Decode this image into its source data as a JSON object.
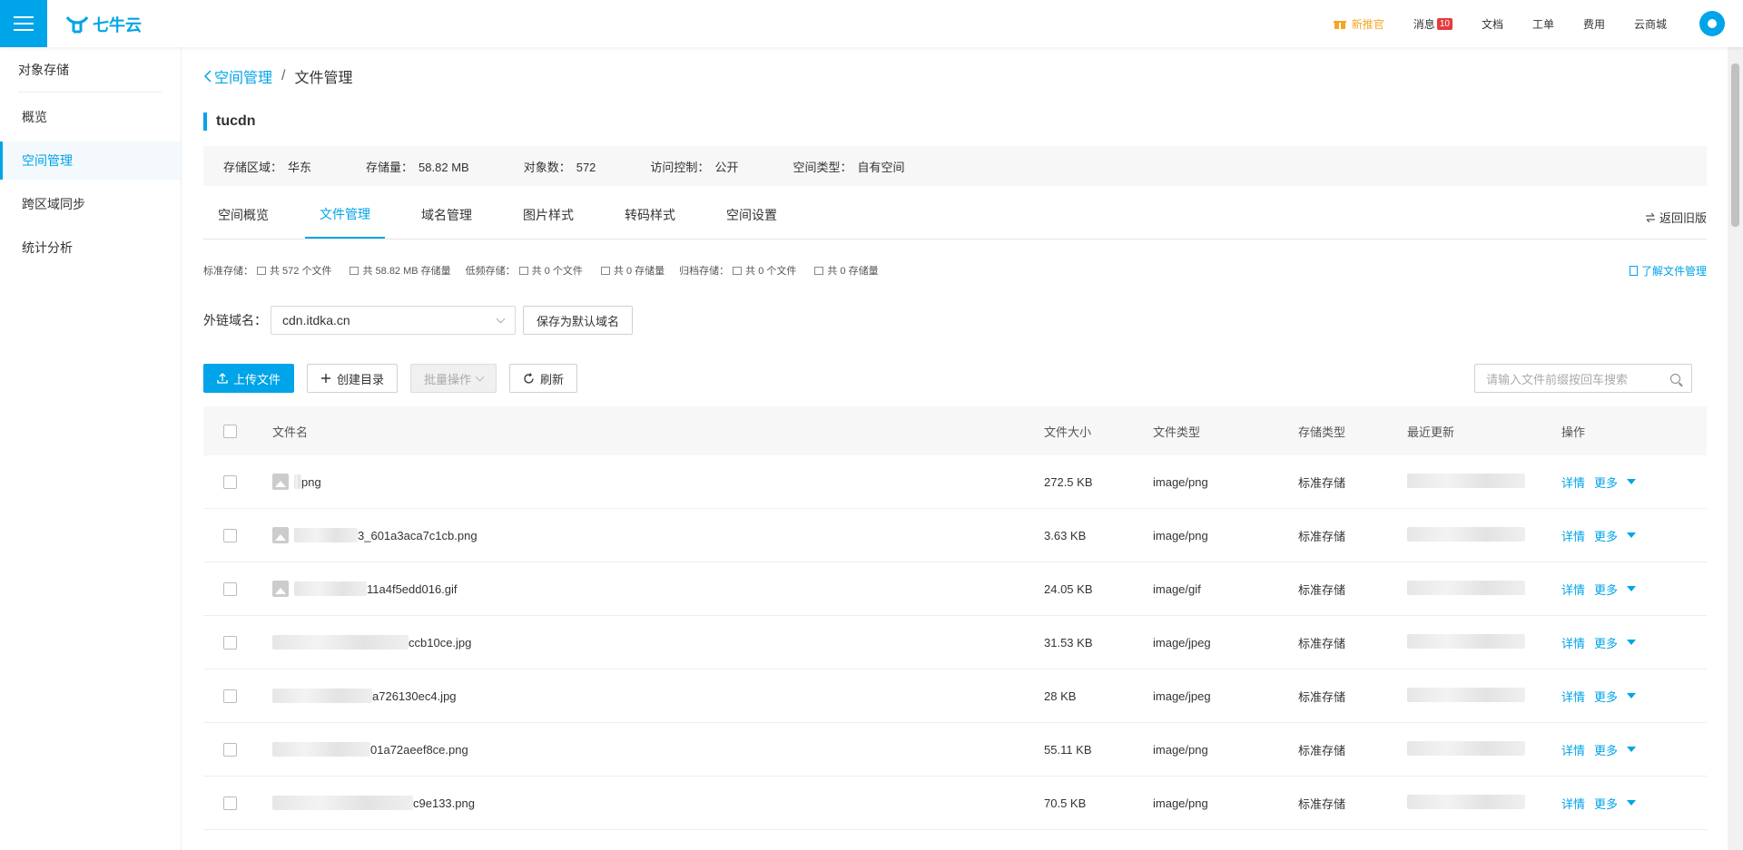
{
  "header": {
    "logo_text": "七牛云",
    "promo": "新推官",
    "messages": "消息",
    "messages_count": "10",
    "docs": "文档",
    "tickets": "工单",
    "billing": "费用",
    "mall": "云商城"
  },
  "sidebar": {
    "title": "对象存储",
    "items": [
      {
        "label": "概览"
      },
      {
        "label": "空间管理"
      },
      {
        "label": "跨区域同步"
      },
      {
        "label": "统计分析"
      }
    ]
  },
  "breadcrumb": {
    "back": "空间管理",
    "separator": "/",
    "current": "文件管理"
  },
  "bucket": {
    "name": "tucdn",
    "region_label": "存储区域：",
    "region": "华东",
    "usage_label": "存储量：",
    "usage": "58.82 MB",
    "objects_label": "对象数：",
    "objects": "572",
    "access_label": "访问控制：",
    "access": "公开",
    "type_label": "空间类型：",
    "type": "自有空间"
  },
  "tabs": [
    {
      "label": "空间概览"
    },
    {
      "label": "文件管理"
    },
    {
      "label": "域名管理"
    },
    {
      "label": "图片样式"
    },
    {
      "label": "转码样式"
    },
    {
      "label": "空间设置"
    }
  ],
  "old_version": "返回旧版",
  "stats": {
    "standard": "标准存储：",
    "standard_files": "共 572 个文件",
    "standard_size": "共 58.82 MB 存储量",
    "low": "低频存储：",
    "low_files": "共 0 个文件",
    "low_size": "共 0 存储量",
    "archive": "归档存储：",
    "archive_files": "共 0 个文件",
    "archive_size": "共 0 存储量",
    "learn": "了解文件管理"
  },
  "domain": {
    "label": "外链域名：",
    "value": "cdn.itdka.cn",
    "save_btn": "保存为默认域名"
  },
  "toolbar": {
    "upload": "上传文件",
    "mkdir": "创建目录",
    "batch": "批量操作",
    "refresh": "刷新",
    "search_placeholder": "请输入文件前缀按回车搜索"
  },
  "table": {
    "headers": {
      "name": "文件名",
      "size": "文件大小",
      "type": "文件类型",
      "storage": "存储类型",
      "updated": "最近更新",
      "ops": "操作"
    },
    "detail": "详情",
    "more": "更多",
    "rows": [
      {
        "name": "png",
        "size": "272.5 KB",
        "type": "image/png",
        "storage": "标准存储"
      },
      {
        "name": "3_601a3aca7c1cb.png",
        "size": "3.63 KB",
        "type": "image/png",
        "storage": "标准存储"
      },
      {
        "name": "11a4f5edd016.gif",
        "size": "24.05 KB",
        "type": "image/gif",
        "storage": "标准存储"
      },
      {
        "name": "ccb10ce.jpg",
        "size": "31.53 KB",
        "type": "image/jpeg",
        "storage": "标准存储"
      },
      {
        "name": "a726130ec4.jpg",
        "size": "28 KB",
        "type": "image/jpeg",
        "storage": "标准存储"
      },
      {
        "name": "01a72aeef8ce.png",
        "size": "55.11 KB",
        "type": "image/png",
        "storage": "标准存储"
      },
      {
        "name": "c9e133.png",
        "size": "70.5 KB",
        "type": "image/png",
        "storage": "标准存储"
      }
    ]
  }
}
